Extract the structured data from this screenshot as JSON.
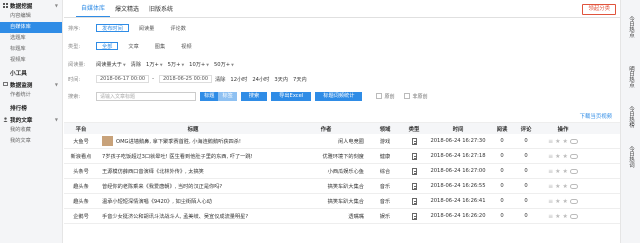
{
  "sidebar": {
    "sections": [
      {
        "title": "数据挖掘",
        "items": [
          "内容编辑",
          "自媒体库",
          "选题库",
          "标题库",
          "视频库"
        ],
        "active": 1
      },
      {
        "title": "小工具",
        "items": []
      },
      {
        "title": "数据监测",
        "items": [
          "作者统计"
        ]
      },
      {
        "title": "排行榜",
        "items": []
      },
      {
        "title": "我的文章",
        "items": [
          "我的收藏",
          "我的文章"
        ]
      }
    ]
  },
  "tabs": [
    "自媒体库",
    "爆文精选",
    "旧版系统"
  ],
  "red_button": "领起分类",
  "filters": {
    "sort_label": "排序:",
    "sort_options": [
      "发布时间",
      "阅读量",
      "评论数"
    ],
    "type_label": "类型:",
    "type_options": [
      "全部",
      "文章",
      "图集",
      "视频"
    ],
    "read_label": "阅读量:",
    "read_dropdown": "阅读量大于",
    "read_clear": "清除",
    "read_options": [
      "1万+",
      "5万+",
      "10万+",
      "50万+"
    ],
    "time_label": "时间:",
    "date_from": "2018-06-17 00:00",
    "date_sep": "-",
    "date_to": "2018-06-25 00:00",
    "time_clear": "清除",
    "time_options": [
      "12小时",
      "24小时",
      "3天内",
      "7天内"
    ],
    "search_label": "搜索:",
    "search_placeholder": "请输入文章标题",
    "btn_title": "标题",
    "btn_tag": "标签",
    "btn_search": "搜索",
    "btn_export": "导出Excel",
    "btn_stats": "标题词频统计",
    "chk_original": "原创",
    "chk_not_original": "非原创"
  },
  "download_link": "下载当页视频",
  "table": {
    "headers": [
      "平台",
      "标题",
      "作者",
      "领域",
      "类型",
      "时间",
      "阅读",
      "评论",
      "操作"
    ],
    "rows": [
      {
        "platform": "大鱼号",
        "title": "OMG进墙鹅鼻, 拿下聚季赛首胜, 小海连鹅鹅听获四杀!",
        "thumb": true,
        "author": "闲人电竞圈",
        "field": "游戏",
        "time": "2018-06-24 16:27:30",
        "read": "0",
        "comment": "0"
      },
      {
        "platform": "新浪看点",
        "title": "7岁孩子吃饭超过3口就晕吐! 医生看到他肚子里的东西, 吓了一跳!",
        "thumb": false,
        "author": "优雅环境下的刻度",
        "field": "健康",
        "time": "2018-06-24 16:27:18",
        "read": "0",
        "comment": "0"
      },
      {
        "platform": "头条号",
        "title": "王源模仿薛西口音演绎《北林外传》, 太搞笑",
        "thumb": false,
        "author": "小西瓜娱乐心鱼",
        "field": "综合",
        "time": "2018-06-24 16:27:00",
        "read": "0",
        "comment": "0"
      },
      {
        "platform": "趣头条",
        "title": "曾经你的老陈乘来《我爱唐朝》, 当时的汉正是你吗?",
        "thumb": false,
        "author": "搞笑车趴大集合",
        "field": "音乐",
        "time": "2018-06-24 16:26:55",
        "read": "0",
        "comment": "0"
      },
      {
        "platform": "趣头条",
        "title": "温承小短短深情演唱《9420》, 如尘街陌人心动",
        "thumb": false,
        "author": "搞笑车趴大集合",
        "field": "音乐",
        "time": "2018-06-24 16:26:41",
        "read": "0",
        "comment": "0"
      },
      {
        "platform": "企鹅号",
        "title": "手音少女挺济公和胡讯斗法战斗人, 孟美岐、吴宣仪成流量明星?",
        "thumb": false,
        "author": "透嘴嘴",
        "field": "娱乐",
        "time": "2018-06-24 16:26:20",
        "read": "0",
        "comment": "0"
      }
    ]
  },
  "right_bar": [
    "今日热点",
    "明日热点",
    "今日热榜",
    "今日热词"
  ]
}
